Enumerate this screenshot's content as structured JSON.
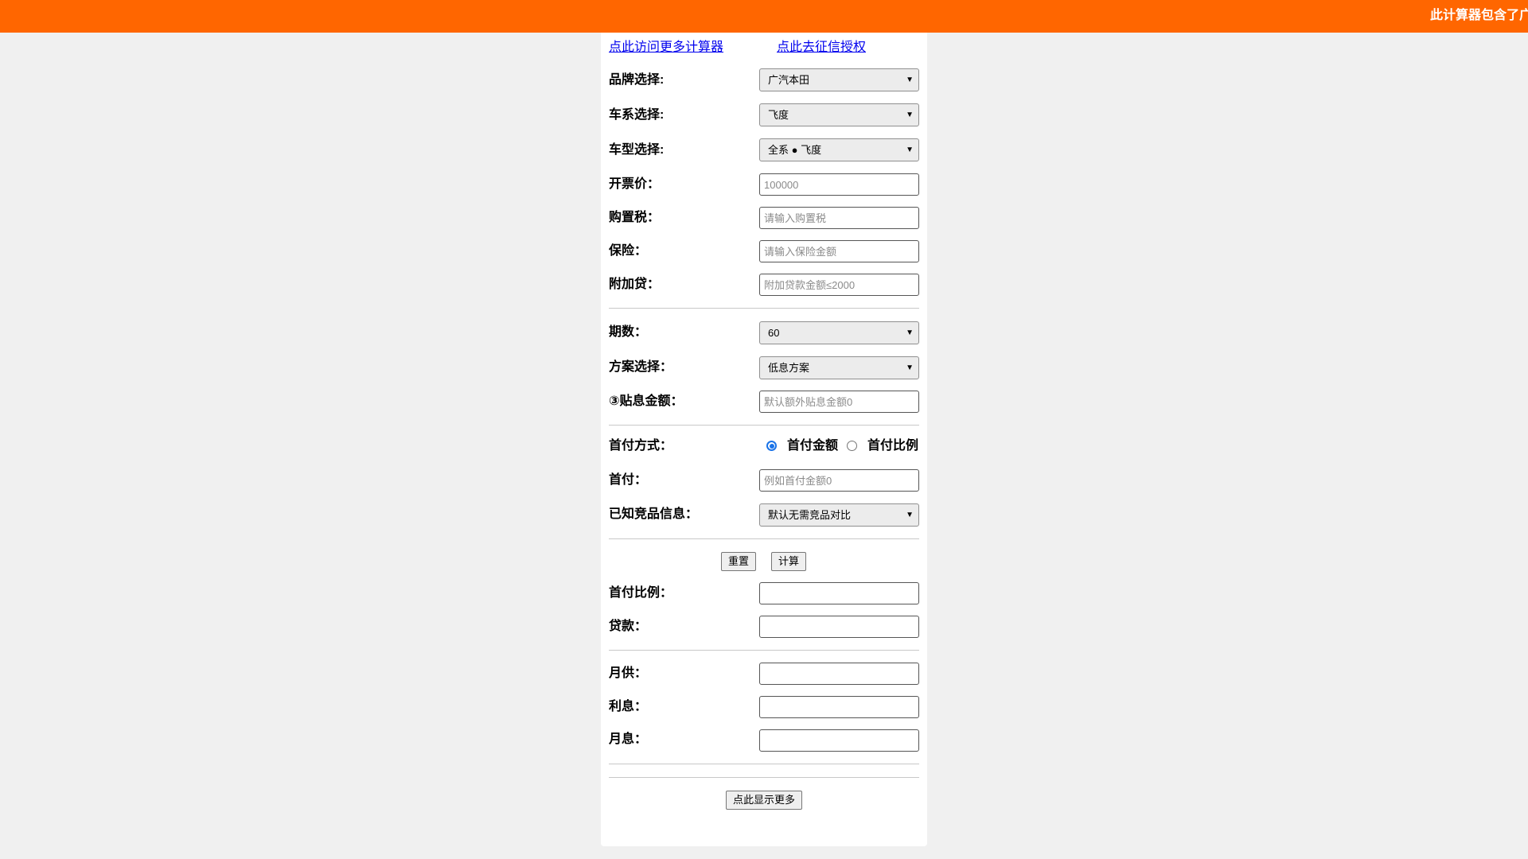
{
  "banner": {
    "marquee": "此计算器包含了广"
  },
  "links": {
    "more_calculators": "点此访问更多计算器",
    "credit_auth": "点此去征信授权"
  },
  "form": {
    "brand": {
      "label": "品牌选择:",
      "value": "广汽本田"
    },
    "series": {
      "label": "车系选择:",
      "value": "飞度"
    },
    "model": {
      "label": "车型选择:",
      "value": "全系 ● 飞度"
    },
    "invoice_price": {
      "label": "开票价：",
      "value": "",
      "placeholder": "100000"
    },
    "purchase_tax": {
      "label": "购置税：",
      "value": "",
      "placeholder": "请输入购置税"
    },
    "insurance": {
      "label": "保险：",
      "value": "",
      "placeholder": "请输入保险金额"
    },
    "extra_loan": {
      "label": "附加贷：",
      "value": "",
      "placeholder": "附加贷款金额≤2000"
    },
    "term": {
      "label": "期数：",
      "value": "60"
    },
    "plan": {
      "label": "方案选择：",
      "value": "低息方案"
    },
    "subsidy": {
      "label": "③贴息金额：",
      "value": "",
      "placeholder": "默认额外贴息金额0"
    },
    "down_payment_mode": {
      "label": "首付方式：",
      "options": [
        "首付金额",
        "首付比例"
      ],
      "selected": "首付金额"
    },
    "down_payment": {
      "label": "首付：",
      "value": "",
      "placeholder": "例如首付金额0"
    },
    "competitor": {
      "label": "已知竞品信息：",
      "value": "默认无需竞品对比"
    }
  },
  "actions": {
    "reset": "重置",
    "calculate": "计算",
    "show_more": "点此显示更多"
  },
  "results": {
    "down_ratio": {
      "label": "首付比例：",
      "value": ""
    },
    "loan": {
      "label": "贷款：",
      "value": ""
    },
    "monthly_payment": {
      "label": "月供：",
      "value": ""
    },
    "interest": {
      "label": "利息：",
      "value": ""
    },
    "monthly_interest": {
      "label": "月息：",
      "value": ""
    }
  },
  "icons": {
    "select_arrow": "chevron-down-icon"
  },
  "colors": {
    "banner": "#ff6600",
    "link": "#0000ee",
    "radio_checked": "#1a73e8",
    "page_background": "#f0f0f0",
    "panel_background": "#ffffff"
  }
}
